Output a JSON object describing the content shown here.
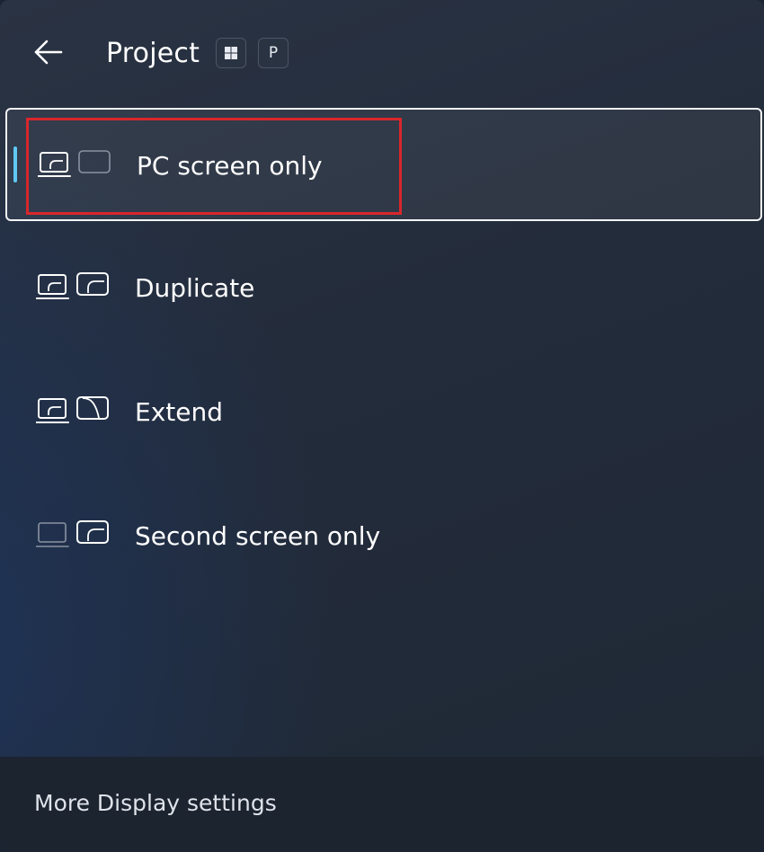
{
  "header": {
    "title": "Project",
    "shortcut_keys": {
      "win_icon": "windows-logo-icon",
      "letter": "P"
    },
    "back_icon": "back-arrow-icon"
  },
  "options": [
    {
      "label": "PC screen only",
      "icon": "pc-screen-only-icon",
      "selected": true
    },
    {
      "label": "Duplicate",
      "icon": "duplicate-icon",
      "selected": false
    },
    {
      "label": "Extend",
      "icon": "extend-icon",
      "selected": false
    },
    {
      "label": "Second screen only",
      "icon": "second-screen-only-icon",
      "selected": false
    }
  ],
  "footer": {
    "link_label": "More Display settings"
  },
  "colors": {
    "accent": "#60c8f5",
    "highlight_box": "#d9262c",
    "selected_border": "#f2f4f7"
  }
}
